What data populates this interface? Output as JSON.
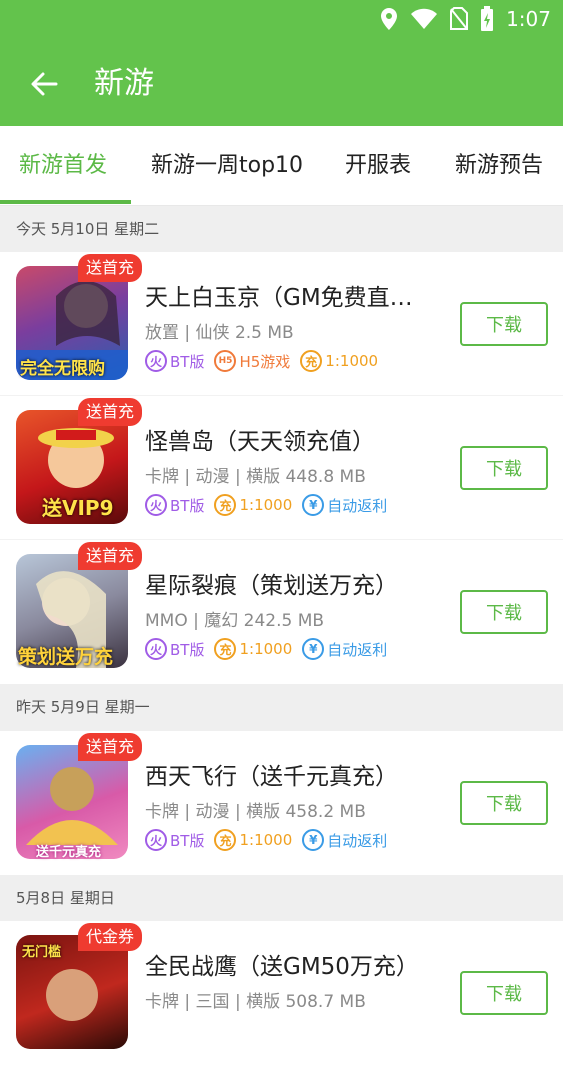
{
  "status_bar": {
    "time": "1:07"
  },
  "app_bar": {
    "title": "新游"
  },
  "tabs": [
    {
      "label": "新游首发",
      "active": true
    },
    {
      "label": "新游一周top10",
      "active": false
    },
    {
      "label": "开服表",
      "active": false
    },
    {
      "label": "新游预告",
      "active": false
    }
  ],
  "sections": [
    {
      "header": "今天 5月10日 星期二"
    },
    {
      "header": "昨天 5月9日 星期一"
    },
    {
      "header": "5月8日 星期日"
    }
  ],
  "games": [
    {
      "name": "天上白玉京（GM免费直…",
      "meta": "放置 | 仙侠 2.5 MB",
      "badge": "送首充",
      "tags": [
        {
          "type": "bt",
          "label": "BT版"
        },
        {
          "type": "h5",
          "label": "H5游戏"
        },
        {
          "type": "recharge",
          "label": "1:1000"
        }
      ],
      "button": "下载",
      "thumb_text": "完全无限购"
    },
    {
      "name": "怪兽岛（天天领充值）",
      "meta": "卡牌 | 动漫 | 横版 448.8 MB",
      "badge": "送首充",
      "tags": [
        {
          "type": "bt",
          "label": "BT版"
        },
        {
          "type": "recharge",
          "label": "1:1000"
        },
        {
          "type": "rebate",
          "label": "自动返利"
        }
      ],
      "button": "下载",
      "thumb_text": "送VIP9"
    },
    {
      "name": "星际裂痕（策划送万充）",
      "meta": "MMO | 魔幻 242.5 MB",
      "badge": "送首充",
      "tags": [
        {
          "type": "bt",
          "label": "BT版"
        },
        {
          "type": "recharge",
          "label": "1:1000"
        },
        {
          "type": "rebate",
          "label": "自动返利"
        }
      ],
      "button": "下载",
      "thumb_text": "策划送万充"
    },
    {
      "name": "西天飞行（送千元真充）",
      "meta": "卡牌 | 动漫 | 横版 458.2 MB",
      "badge": "送首充",
      "tags": [
        {
          "type": "bt",
          "label": "BT版"
        },
        {
          "type": "recharge",
          "label": "1:1000"
        },
        {
          "type": "rebate",
          "label": "自动返利"
        }
      ],
      "button": "下载",
      "thumb_text": "送千元真充"
    },
    {
      "name": "全民战鹰（送GM50万充）",
      "meta": "卡牌 | 三国 | 横版 508.7 MB",
      "badge": "代金券",
      "tags": [],
      "button": "下载",
      "thumb_text": "无门槛"
    }
  ],
  "tag_icons": {
    "bt": "火",
    "h5": "H5",
    "recharge": "充",
    "rebate": "¥"
  },
  "colors": {
    "primary": "#63c34c",
    "accent_green": "#5cb947",
    "badge_red": "#ef3b30",
    "bt_purple": "#a05ce6",
    "h5_orange": "#f07a3a",
    "recharge_gold": "#f0a020",
    "rebate_blue": "#3a9be6"
  }
}
